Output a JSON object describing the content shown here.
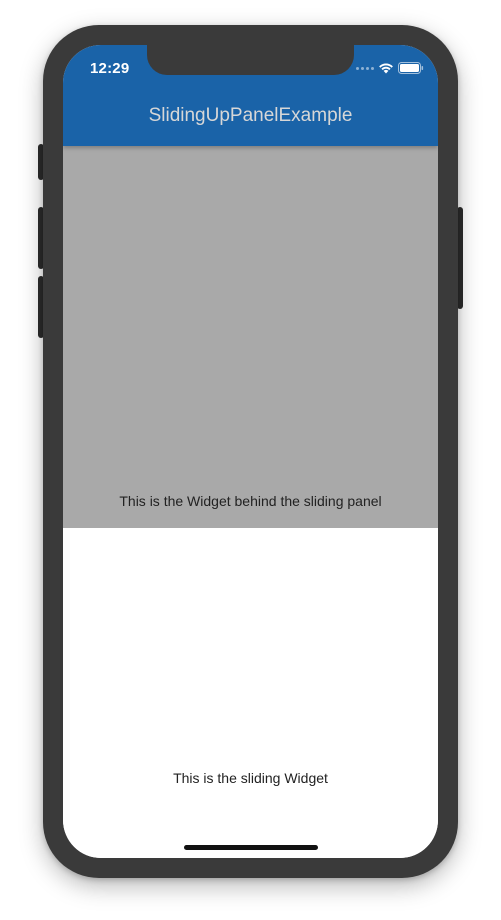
{
  "status_bar": {
    "time": "12:29"
  },
  "app_bar": {
    "title": "SlidingUpPanelExample",
    "color": "#1a63a8"
  },
  "body": {
    "behind_text": "This is the Widget behind the sliding panel",
    "behind_color": "#a9a9a9"
  },
  "panel": {
    "text": "This is the sliding Widget"
  },
  "icons": [
    "signal-dots-icon",
    "wifi-icon",
    "battery-icon"
  ]
}
